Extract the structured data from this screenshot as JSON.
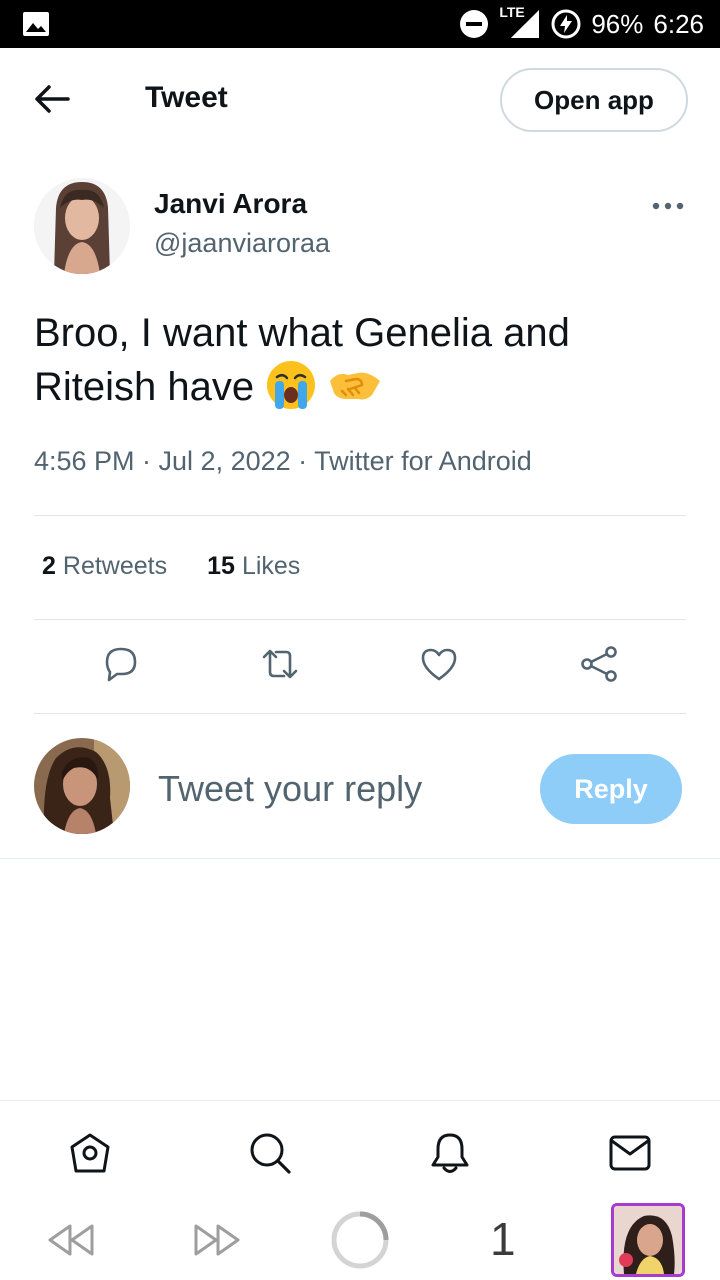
{
  "status_bar": {
    "network": "LTE",
    "battery": "96%",
    "time": "6:26"
  },
  "header": {
    "title": "Tweet",
    "open_app_label": "Open app"
  },
  "tweet": {
    "author_name": "Janvi Arora",
    "author_handle": "@jaanviaroraa",
    "text": "Broo, I want what Genelia and Riteish have",
    "emojis": [
      "loudly-crying-face",
      "handshake"
    ],
    "meta": "4:56 PM · Jul 2, 2022 · Twitter for Android",
    "retweets_count": "2",
    "retweets_label": "Retweets",
    "likes_count": "15",
    "likes_label": "Likes"
  },
  "reply": {
    "placeholder": "Tweet your reply",
    "button_label": "Reply"
  },
  "bottom_nav": [
    "home-icon",
    "search-icon",
    "notifications-icon",
    "messages-icon"
  ],
  "browser": {
    "tab_count": "1"
  },
  "colors": {
    "accent": "#1d9bf0",
    "reply_button_disabled": "#8ecdf8",
    "secondary_text": "#536471",
    "tab_border": "#a63bd0"
  }
}
